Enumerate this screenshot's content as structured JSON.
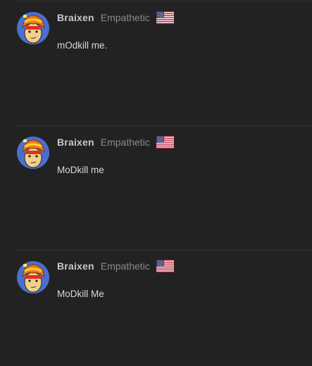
{
  "posts": [
    {
      "username": "Braixen",
      "title": "Empathetic",
      "flag_icon": "us-flag-icon",
      "message": "mOdkill me."
    },
    {
      "username": "Braixen",
      "title": "Empathetic",
      "flag_icon": "us-flag-icon",
      "message": "MoDkill me"
    },
    {
      "username": "Braixen",
      "title": "Empathetic",
      "flag_icon": "us-flag-icon",
      "message": "MoDkill Me"
    }
  ],
  "colors": {
    "background": "#222222",
    "divider": "#333333",
    "username": "#c8c8c8",
    "title": "#8a8a8a",
    "message": "#d8d8d8"
  }
}
